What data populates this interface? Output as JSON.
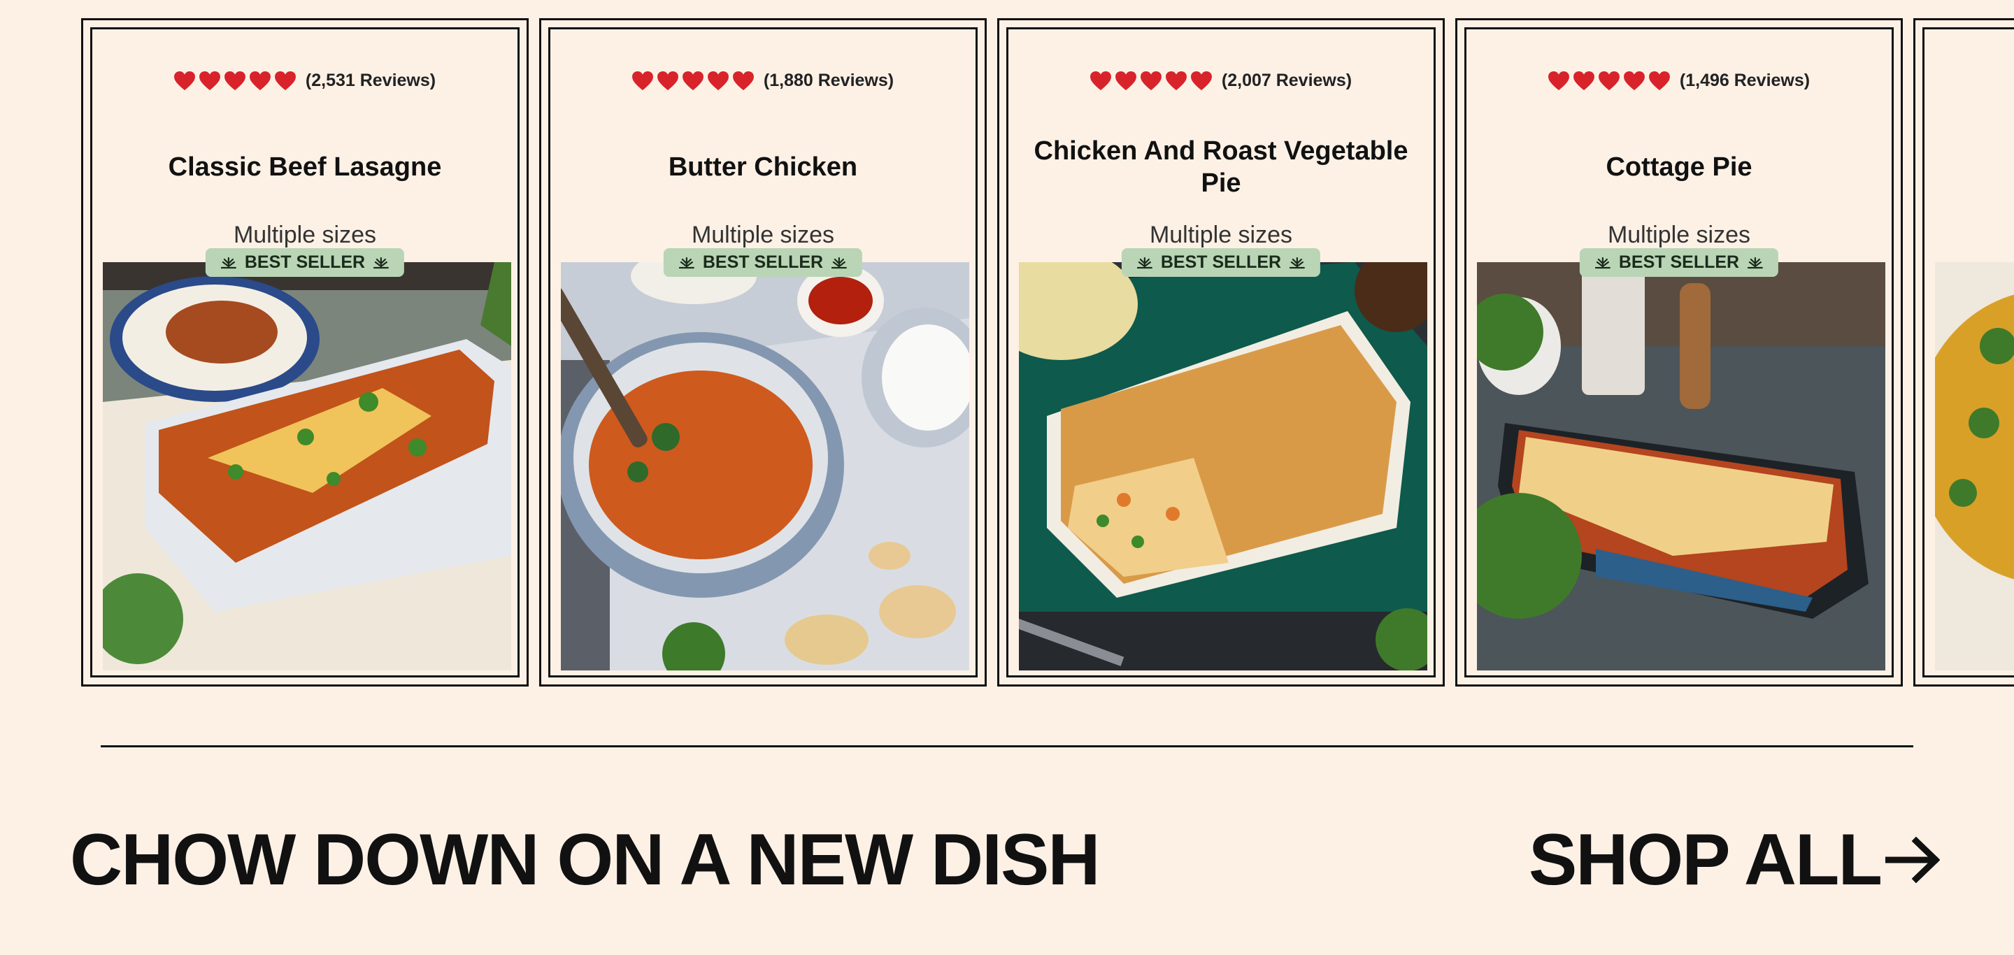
{
  "products": [
    {
      "rating_stars": 5,
      "reviews": "(2,531 Reviews)",
      "title": "Classic Beef Lasagne",
      "sizes": "Multiple sizes",
      "badge": "BEST SELLER",
      "image": "lasagne-photo"
    },
    {
      "rating_stars": 5,
      "reviews": "(1,880 Reviews)",
      "title": "Butter Chicken",
      "sizes": "Multiple sizes",
      "badge": "BEST SELLER",
      "image": "butter-chicken-photo"
    },
    {
      "rating_stars": 5,
      "reviews": "(2,007 Reviews)",
      "title": "Chicken And Roast Vegetable Pie",
      "sizes": "Multiple sizes",
      "badge": "BEST SELLER",
      "image": "chicken-pie-photo"
    },
    {
      "rating_stars": 5,
      "reviews": "(1,496 Reviews)",
      "title": "Cottage Pie",
      "sizes": "Multiple sizes",
      "badge": "BEST SELLER",
      "image": "cottage-pie-photo"
    }
  ],
  "section": {
    "headline": "CHOW DOWN ON A NEW DISH",
    "shop_all": "SHOP ALL"
  },
  "colors": {
    "background": "#fdf1e6",
    "heart": "#d8232a",
    "badge": "#b9d5b6",
    "text": "#111111"
  },
  "icons": {
    "rating": "heart-icon",
    "badge": "leaf-icon",
    "shop_all": "arrow-right-icon"
  }
}
